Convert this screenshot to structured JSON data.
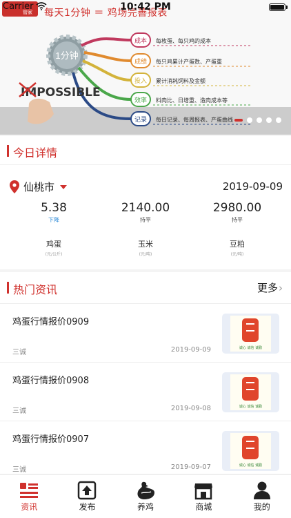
{
  "status_bar": {
    "carrier": "Carrier",
    "time": "10:42 PM"
  },
  "banner": {
    "app_logo_text": "管家",
    "headline": "每天1分钟 ＝ 鸡场完善报表",
    "gear_label": "1分钟",
    "impossible_text": "IMPOSSIBLE",
    "branches": [
      {
        "tag": "成本",
        "text": "每枚蛋、每只鸡的成本",
        "color": "#c0395e"
      },
      {
        "tag": "成绩",
        "text": "每只鸡累计产蛋数、产蛋重",
        "color": "#e08a2e"
      },
      {
        "tag": "投入",
        "text": "累计消耗饲料及金额",
        "color": "#d3b33a"
      },
      {
        "tag": "效率",
        "text": "料肉比、日增重、造肉成本等",
        "color": "#4aa74a"
      },
      {
        "tag": "记录",
        "text": "每日记录、每周报表、产蛋曲线",
        "color": "#2b4a86"
      }
    ],
    "slide_count": 5,
    "active_slide": 1
  },
  "today": {
    "section_title": "今日详情",
    "city": "仙桃市",
    "date": "2019-09-09",
    "items": [
      {
        "price": "5.38",
        "trend": "下降",
        "trend_type": "down",
        "name": "鸡蛋",
        "unit": "(元/公斤)"
      },
      {
        "price": "2140.00",
        "trend": "持平",
        "trend_type": "flat",
        "name": "玉米",
        "unit": "(元/吨)"
      },
      {
        "price": "2980.00",
        "trend": "持平",
        "trend_type": "flat",
        "name": "豆粕",
        "unit": "(元/吨)"
      }
    ]
  },
  "news": {
    "section_title": "热门资讯",
    "more_label": "更多",
    "thumb_motto": "诚心 诚信 诚勤",
    "items": [
      {
        "title": "鸡蛋行情报价0909",
        "source": "三诚",
        "date": "2019-09-09"
      },
      {
        "title": "鸡蛋行情报价0908",
        "source": "三诚",
        "date": "2019-09-08"
      },
      {
        "title": "鸡蛋行情报价0907",
        "source": "三诚",
        "date": "2019-09-07"
      }
    ]
  },
  "tabbar": {
    "tabs": [
      {
        "label": "资讯",
        "icon": "news-icon",
        "active": true
      },
      {
        "label": "发布",
        "icon": "upload-icon",
        "active": false
      },
      {
        "label": "养鸡",
        "icon": "chicken-icon",
        "active": false
      },
      {
        "label": "商城",
        "icon": "store-icon",
        "active": false
      },
      {
        "label": "我的",
        "icon": "profile-icon",
        "active": false
      }
    ]
  },
  "colors": {
    "accent": "#d0312d",
    "trend_down": "#2a88d6"
  }
}
